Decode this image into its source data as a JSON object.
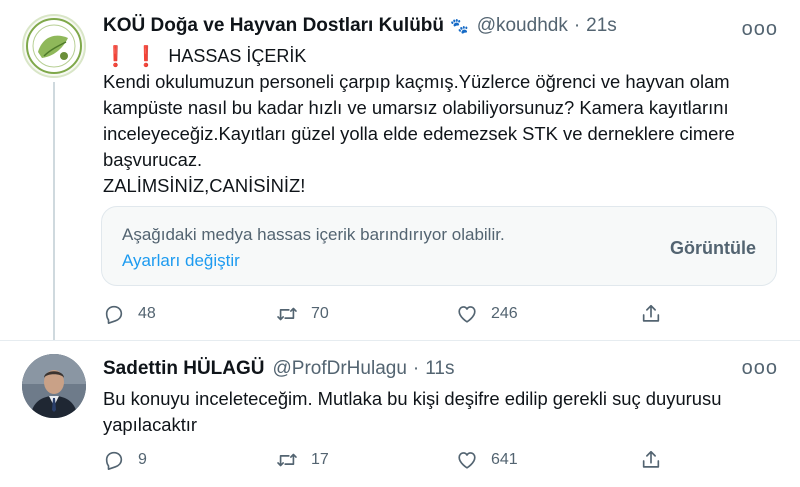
{
  "tweets": [
    {
      "display_name": "KOÜ Doğa ve Hayvan Dostları Kulübü",
      "emoji": "🐾",
      "handle": "@koudhdk",
      "dot": "·",
      "time": "21s",
      "more": "ooo",
      "warning_marks": "❗ ❗",
      "warning_label": "HASSAS İÇERİK",
      "text_lines": [
        "Kendi okulumuzun personeli çarpıp kaçmış.Yüzlerce öğrenci ve hayvan olam",
        "kampüste nasıl bu kadar hızlı ve umarsız olabiliyorsunuz? Kamera kayıtlarını",
        "inceleyeceğiz.Kayıtları güzel yolla elde edemezsek STK ve derneklere cimere",
        "başvurucaz.",
        "ZALİMSİNİZ,CANİSİNİZ!"
      ],
      "media": {
        "warning": "Aşağıdaki medya hassas içerik barındırıyor olabilir.",
        "settings_link": "Ayarları değiştir",
        "view_button": "Görüntüle"
      },
      "counts": {
        "replies": "48",
        "retweets": "70",
        "likes": "246"
      }
    },
    {
      "display_name": "Sadettin HÜLAGÜ",
      "handle": "@ProfDrHulagu",
      "dot": "·",
      "time": "11s",
      "more": "ooo",
      "text_lines": [
        "Bu konuyu inceleteceğim. Mutlaka bu kişi deşifre edilip gerekli suç duyurusu",
        "yapılacaktır"
      ],
      "counts": {
        "replies": "9",
        "retweets": "17",
        "likes": "641"
      }
    }
  ],
  "icons": {
    "reply": "reply-icon",
    "retweet": "retweet-icon",
    "like": "heart-icon",
    "share": "share-icon",
    "more": "more-options-icon"
  },
  "colors": {
    "text": "#0f1419",
    "secondary": "#536471",
    "link": "#1d9bf0",
    "warning_mark": "#e0242b",
    "border": "#e1e8ed"
  }
}
